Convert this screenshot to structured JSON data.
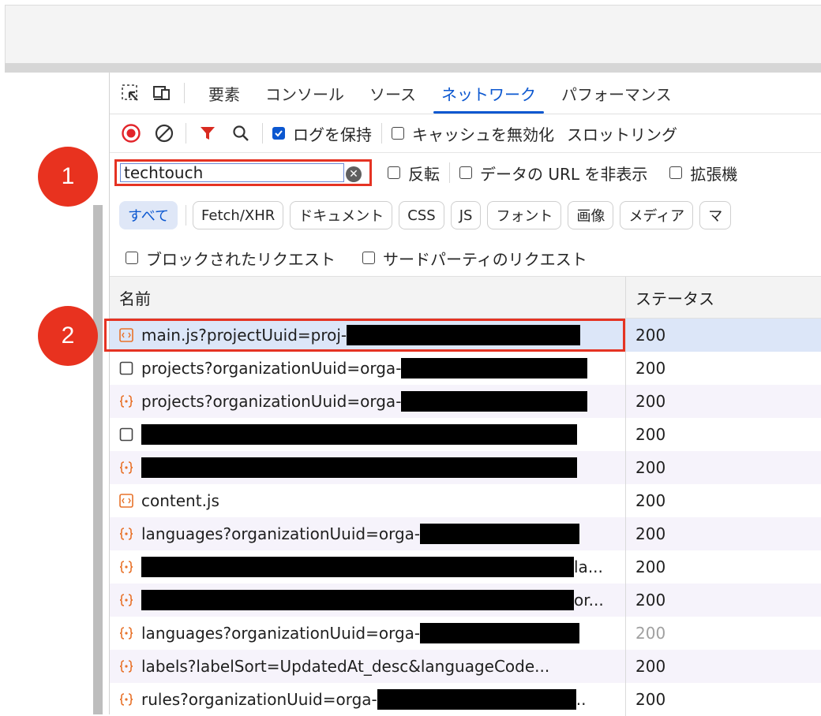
{
  "tabs": {
    "items": [
      "要素",
      "コンソール",
      "ソース",
      "ネットワーク",
      "パフォーマンス"
    ],
    "active": "ネットワーク"
  },
  "toolbar": {
    "preserve_log_label": "ログを保持",
    "disable_cache_label": "キャッシュを無効化",
    "throttling_label": "スロットリング"
  },
  "filter": {
    "value": "techtouch",
    "invert_label": "反転",
    "hide_data_urls_label": "データの URL を非表示",
    "extensions_label": "拡張機"
  },
  "types": [
    "すべて",
    "Fetch/XHR",
    "ドキュメント",
    "CSS",
    "JS",
    "フォント",
    "画像",
    "メディア",
    "マ"
  ],
  "extra_checks": {
    "blocked_label": "ブロックされたリクエスト",
    "third_party_label": "サードパーティのリクエスト"
  },
  "table": {
    "col_name": "名前",
    "col_status": "ステータス",
    "rows": [
      {
        "name": "main.js?projectUuid=proj-",
        "suffix": "",
        "status": "200",
        "icon": "script-icon"
      },
      {
        "name": "projects?organizationUuid=orga-",
        "suffix": "",
        "status": "200",
        "icon": "document-icon"
      },
      {
        "name": "projects?organizationUuid=orga-",
        "suffix": "",
        "status": "200",
        "icon": "fetch-icon"
      },
      {
        "name": "",
        "suffix": "",
        "status": "200",
        "icon": "document-icon"
      },
      {
        "name": "",
        "suffix": "",
        "status": "200",
        "icon": "fetch-icon"
      },
      {
        "name": "content.js",
        "suffix": "",
        "status": "200",
        "icon": "script-icon"
      },
      {
        "name": "languages?organizationUuid=orga-",
        "suffix": "",
        "status": "200",
        "icon": "fetch-icon"
      },
      {
        "name": "",
        "suffix": "la...",
        "status": "200",
        "icon": "fetch-icon"
      },
      {
        "name": "",
        "suffix": "or...",
        "status": "200",
        "icon": "fetch-icon"
      },
      {
        "name": "languages?organizationUuid=orga-",
        "suffix": "",
        "status": "200",
        "icon": "fetch-icon"
      },
      {
        "name": "labels?labelSort=UpdatedAt_desc&languageCode...",
        "suffix": "",
        "status": "200",
        "icon": "fetch-icon"
      },
      {
        "name": "rules?organizationUuid=orga-",
        "suffix": "..",
        "status": "200",
        "icon": "fetch-icon"
      }
    ]
  },
  "callouts": [
    "1",
    "2"
  ],
  "colors": {
    "accent": "#0b57d0",
    "highlight": "#e53323",
    "callout": "#e8321f",
    "record": "#e2242a",
    "filter_icon": "#d92a20"
  }
}
